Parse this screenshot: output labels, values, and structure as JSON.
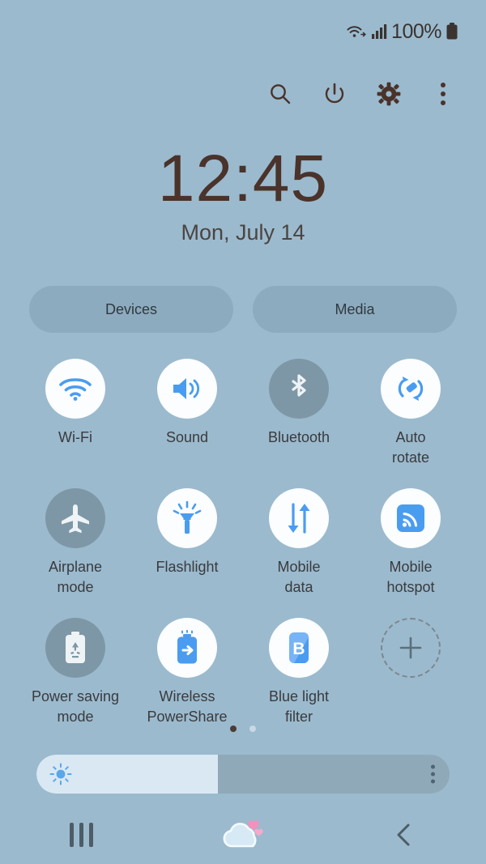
{
  "theme": {
    "background": "#9bbace",
    "accent_blue": "#4a9cf0",
    "tile_on_bg": "#fbfdff",
    "tile_off_bg": "#7e97a6",
    "text_dark": "#4a332b",
    "label_color": "#3a3b3d"
  },
  "status_bar": {
    "wifi_icon": "wifi-signal-icon",
    "cellular_icon": "cellular-bars-icon",
    "battery_percent": "100%",
    "battery_icon": "battery-full-icon"
  },
  "header": {
    "actions": [
      {
        "name": "search-icon",
        "label": "Search"
      },
      {
        "name": "power-icon",
        "label": "Power off"
      },
      {
        "name": "gear-icon",
        "label": "Settings"
      },
      {
        "name": "overflow-menu-icon",
        "label": "More options"
      }
    ]
  },
  "clock": {
    "time": "12:45",
    "date": "Mon, July 14"
  },
  "chips": [
    {
      "label": "Devices",
      "name": "devices-button"
    },
    {
      "label": "Media",
      "name": "media-button"
    }
  ],
  "tiles": [
    {
      "label": "Wi-Fi",
      "icon": "wifi-icon",
      "state": "on"
    },
    {
      "label": "Sound",
      "icon": "sound-icon",
      "state": "on"
    },
    {
      "label": "Bluetooth",
      "icon": "bluetooth-icon",
      "state": "off"
    },
    {
      "label": "Auto\nrotate",
      "icon": "auto-rotate-icon",
      "state": "on"
    },
    {
      "label": "Airplane\nmode",
      "icon": "airplane-icon",
      "state": "off"
    },
    {
      "label": "Flashlight",
      "icon": "flashlight-icon",
      "state": "on"
    },
    {
      "label": "Mobile\ndata",
      "icon": "mobile-data-icon",
      "state": "on"
    },
    {
      "label": "Mobile\nhotspot",
      "icon": "mobile-hotspot-icon",
      "state": "on"
    },
    {
      "label": "Power saving\nmode",
      "icon": "power-saving-icon",
      "state": "off"
    },
    {
      "label": "Wireless\nPowerShare",
      "icon": "power-share-icon",
      "state": "on"
    },
    {
      "label": "Blue light\nfilter",
      "icon": "blue-light-filter-icon",
      "state": "on"
    },
    {
      "label": "",
      "icon": "add-tile-icon",
      "state": "add"
    }
  ],
  "pagination": {
    "total": 2,
    "current": 1
  },
  "brightness": {
    "percent": 44,
    "sun_icon": "brightness-sun-icon",
    "menu_icon": "brightness-options-icon"
  },
  "navigation": [
    {
      "name": "recents-button",
      "label": "Recents"
    },
    {
      "name": "home-button",
      "label": "Home"
    },
    {
      "name": "back-button",
      "label": "Back"
    }
  ]
}
